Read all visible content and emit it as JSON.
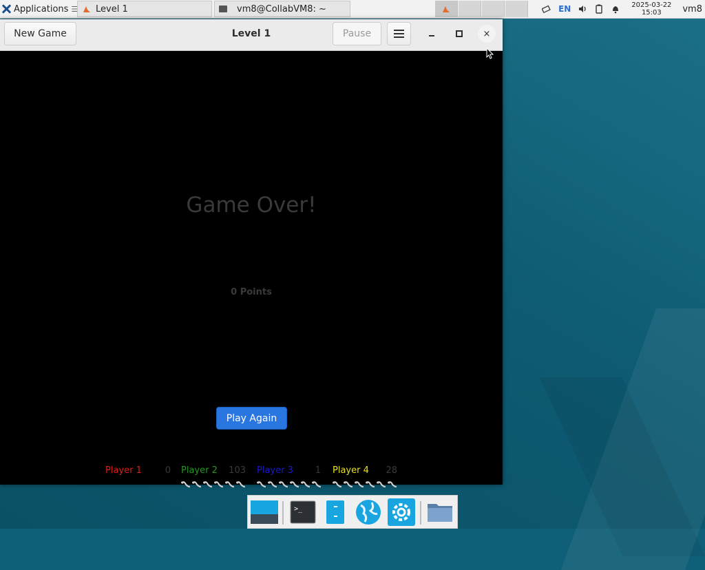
{
  "panel": {
    "apps_label": "Applications",
    "apps_suffix": "☰",
    "tasks": [
      {
        "label": "Level 1"
      },
      {
        "label": "vm8@CollabVM8: ~"
      }
    ],
    "lang": "EN",
    "date": "2025-03-22",
    "time": "15:03",
    "user": "vm8"
  },
  "window": {
    "title": "Level 1",
    "new_game_label": "New Game",
    "pause_label": "Pause"
  },
  "game": {
    "status_text": "Game Over!",
    "points_text": "0 Points",
    "play_again_label": "Play Again",
    "players": [
      {
        "name": "Player 1",
        "score": "0",
        "color": "#e11a1a",
        "lives": 0
      },
      {
        "name": "Player 2",
        "score": "103",
        "color": "#1e9a1e",
        "lives": 6
      },
      {
        "name": "Player 3",
        "score": "1",
        "color": "#1a1acc",
        "lives": 6
      },
      {
        "name": "Player 4",
        "score": "28",
        "color": "#e8e020",
        "lives": 6
      }
    ]
  },
  "dock": {
    "items": [
      "show-desktop",
      "terminal",
      "file-manager-columns",
      "web-browser",
      "settings",
      "home-folder"
    ]
  },
  "colors": {
    "accent": "#2a76e0",
    "desktop": "#0f5f78"
  }
}
